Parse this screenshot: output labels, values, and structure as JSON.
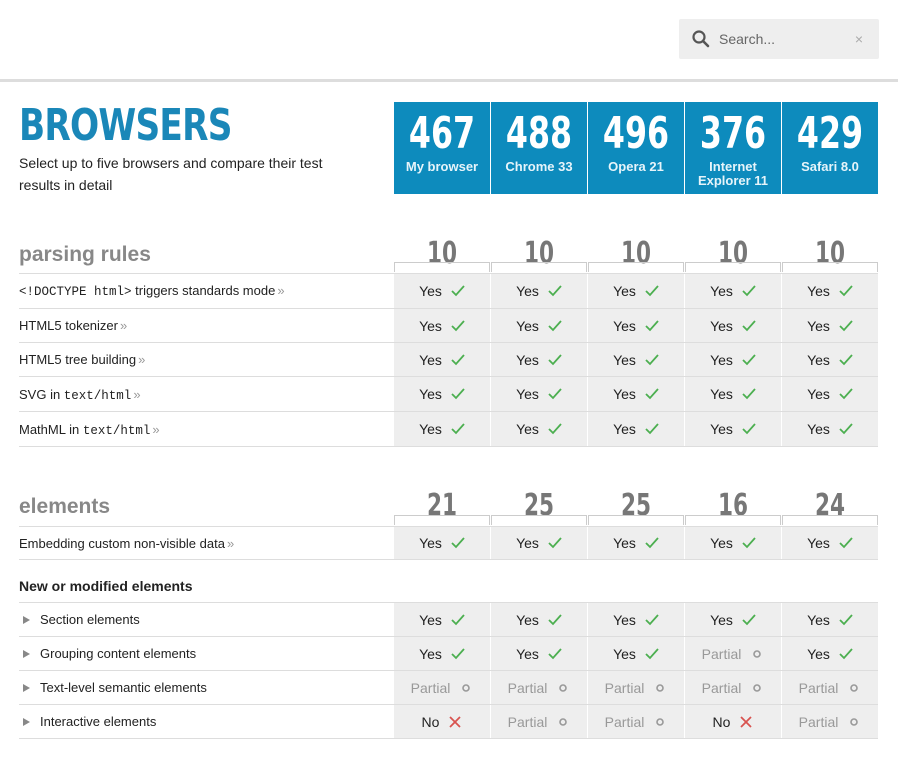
{
  "search": {
    "placeholder": "Search...",
    "clear": "×"
  },
  "page": {
    "title": "BROWSERS",
    "subtitle": "Select up to five browsers and compare their test results in detail"
  },
  "browsers": [
    {
      "score": "467",
      "name": "My browser"
    },
    {
      "score": "488",
      "name": "Chrome 33"
    },
    {
      "score": "496",
      "name": "Opera 21"
    },
    {
      "score": "376",
      "name": "Internet Explorer 11"
    },
    {
      "score": "429",
      "name": "Safari 8.0"
    }
  ],
  "sections": {
    "parsing": {
      "title": "parsing rules",
      "scores": [
        "10",
        "10",
        "10",
        "10",
        "10"
      ],
      "rows": [
        {
          "label_code": "<!DOCTYPE html>",
          "label": " triggers standards mode",
          "more": "»",
          "results": [
            "Yes",
            "Yes",
            "Yes",
            "Yes",
            "Yes"
          ]
        },
        {
          "label": "HTML5 tokenizer",
          "more": "»",
          "results": [
            "Yes",
            "Yes",
            "Yes",
            "Yes",
            "Yes"
          ]
        },
        {
          "label": "HTML5 tree building",
          "more": "»",
          "results": [
            "Yes",
            "Yes",
            "Yes",
            "Yes",
            "Yes"
          ]
        },
        {
          "label": "SVG in ",
          "label_code": "text/html",
          "more": "»",
          "results": [
            "Yes",
            "Yes",
            "Yes",
            "Yes",
            "Yes"
          ]
        },
        {
          "label": "MathML in ",
          "label_code": "text/html",
          "more": "»",
          "results": [
            "Yes",
            "Yes",
            "Yes",
            "Yes",
            "Yes"
          ]
        }
      ]
    },
    "elements": {
      "title": "elements",
      "scores": [
        "21",
        "25",
        "25",
        "16",
        "24"
      ],
      "rows": [
        {
          "label": "Embedding custom non-visible data",
          "more": "»",
          "results": [
            "Yes",
            "Yes",
            "Yes",
            "Yes",
            "Yes"
          ]
        }
      ],
      "group_heading": "New or modified elements",
      "group_rows": [
        {
          "label": "Section elements",
          "results": [
            "Yes",
            "Yes",
            "Yes",
            "Yes",
            "Yes"
          ]
        },
        {
          "label": "Grouping content elements",
          "results": [
            "Yes",
            "Yes",
            "Yes",
            "Partial",
            "Yes"
          ]
        },
        {
          "label": "Text-level semantic elements",
          "results": [
            "Partial",
            "Partial",
            "Partial",
            "Partial",
            "Partial"
          ]
        },
        {
          "label": "Interactive elements",
          "results": [
            "No",
            "Partial",
            "Partial",
            "No",
            "Partial"
          ]
        }
      ]
    }
  },
  "colors": {
    "accent": "#0d8bbd",
    "yes": "#4caf50",
    "no": "#d9534f",
    "partial": "#999999"
  }
}
